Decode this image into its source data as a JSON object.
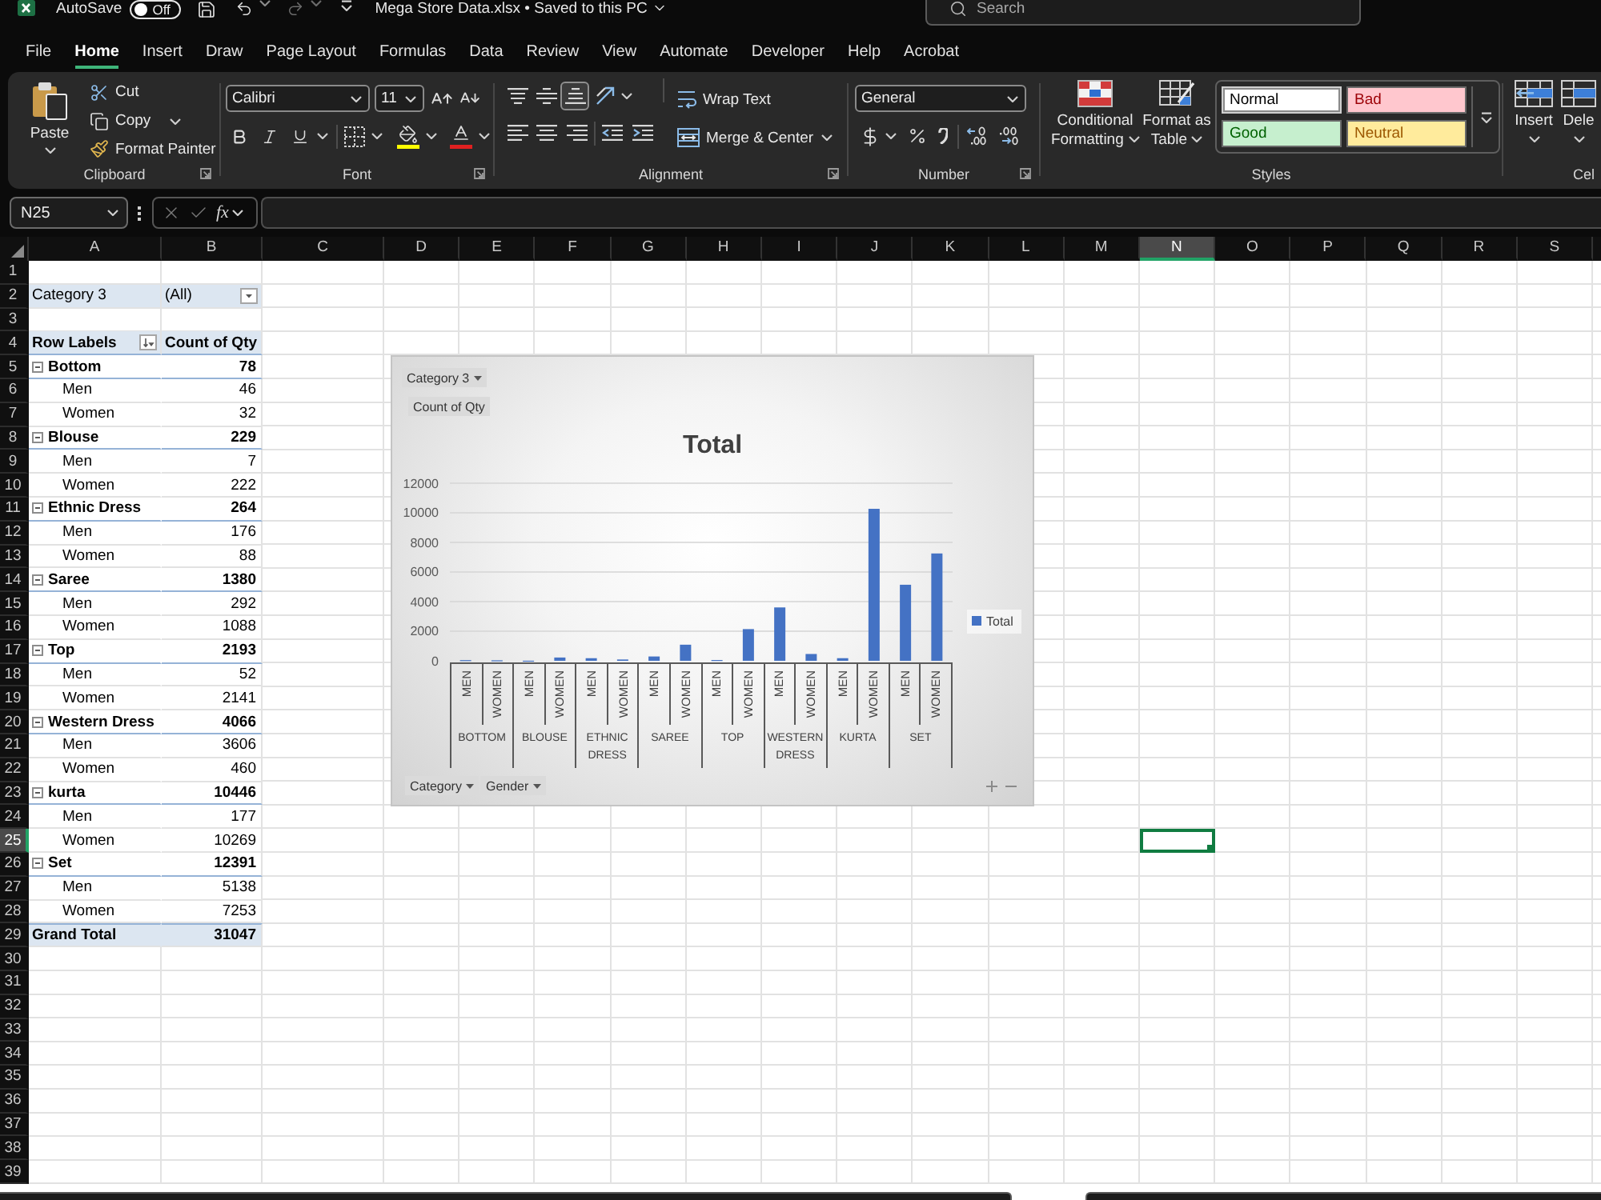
{
  "title_bar": {
    "autosave_label": "AutoSave",
    "autosave_toggle": {
      "label": "Off",
      "on": false
    },
    "document_title": "Mega Store Data.xlsx • Saved to this PC",
    "search": {
      "placeholder": "Search"
    }
  },
  "menu_tabs": [
    {
      "label": "File",
      "selected": false
    },
    {
      "label": "Home",
      "selected": true
    },
    {
      "label": "Insert",
      "selected": false
    },
    {
      "label": "Draw",
      "selected": false
    },
    {
      "label": "Page Layout",
      "selected": false
    },
    {
      "label": "Formulas",
      "selected": false
    },
    {
      "label": "Data",
      "selected": false
    },
    {
      "label": "Review",
      "selected": false
    },
    {
      "label": "View",
      "selected": false
    },
    {
      "label": "Automate",
      "selected": false
    },
    {
      "label": "Developer",
      "selected": false
    },
    {
      "label": "Help",
      "selected": false
    },
    {
      "label": "Acrobat",
      "selected": false
    }
  ],
  "ribbon": {
    "clipboard": {
      "label": "Clipboard",
      "paste": "Paste",
      "cut": "Cut",
      "copy": "Copy",
      "format_painter": "Format Painter"
    },
    "font": {
      "label": "Font",
      "font_name": "Calibri",
      "font_size": "11"
    },
    "alignment": {
      "label": "Alignment",
      "vertical": [
        {
          "kind": "top",
          "on": false
        },
        {
          "kind": "middle",
          "on": false
        },
        {
          "kind": "bottom",
          "on": true
        }
      ],
      "wrap_text": "Wrap Text",
      "merge_center": "Merge & Center"
    },
    "number": {
      "label": "Number",
      "format": "General"
    },
    "styles": {
      "label": "Styles",
      "conditional_formatting": "Conditional Formatting",
      "format_as_table": "Format as Table",
      "gallery": [
        {
          "label": "Normal",
          "kind": "normal",
          "color": "#ffffff"
        },
        {
          "label": "Bad",
          "kind": "bad",
          "color": "#ffc7ce"
        },
        {
          "label": "Good",
          "kind": "good",
          "color": "#c6efce"
        },
        {
          "label": "Neutral",
          "kind": "neutral",
          "color": "#ffeb9c"
        }
      ]
    },
    "cells": {
      "label": "Cel",
      "insert": "Insert",
      "delete": "Dele"
    }
  },
  "formula_bar": {
    "name_box": "N25",
    "function_button": "fx"
  },
  "sheet": {
    "columns": [
      {
        "label": "A",
        "selected": false
      },
      {
        "label": "B",
        "selected": false
      },
      {
        "label": "C",
        "selected": false
      },
      {
        "label": "D",
        "selected": false
      },
      {
        "label": "E",
        "selected": false
      },
      {
        "label": "F",
        "selected": false
      },
      {
        "label": "G",
        "selected": false
      },
      {
        "label": "H",
        "selected": false
      },
      {
        "label": "I",
        "selected": false
      },
      {
        "label": "J",
        "selected": false
      },
      {
        "label": "K",
        "selected": false
      },
      {
        "label": "L",
        "selected": false
      },
      {
        "label": "M",
        "selected": false
      },
      {
        "label": "N",
        "selected": true
      },
      {
        "label": "O",
        "selected": false
      },
      {
        "label": "P",
        "selected": false
      },
      {
        "label": "Q",
        "selected": false
      },
      {
        "label": "R",
        "selected": false
      },
      {
        "label": "S",
        "selected": false
      }
    ],
    "rows": [
      {
        "label": "1",
        "selected": false
      },
      {
        "label": "2",
        "selected": false
      },
      {
        "label": "3",
        "selected": false
      },
      {
        "label": "4",
        "selected": false
      },
      {
        "label": "5",
        "selected": false
      },
      {
        "label": "6",
        "selected": false
      },
      {
        "label": "7",
        "selected": false
      },
      {
        "label": "8",
        "selected": false
      },
      {
        "label": "9",
        "selected": false
      },
      {
        "label": "10",
        "selected": false
      },
      {
        "label": "11",
        "selected": false
      },
      {
        "label": "12",
        "selected": false
      },
      {
        "label": "13",
        "selected": false
      },
      {
        "label": "14",
        "selected": false
      },
      {
        "label": "15",
        "selected": false
      },
      {
        "label": "16",
        "selected": false
      },
      {
        "label": "17",
        "selected": false
      },
      {
        "label": "18",
        "selected": false
      },
      {
        "label": "19",
        "selected": false
      },
      {
        "label": "20",
        "selected": false
      },
      {
        "label": "21",
        "selected": false
      },
      {
        "label": "22",
        "selected": false
      },
      {
        "label": "23",
        "selected": false
      },
      {
        "label": "24",
        "selected": false
      },
      {
        "label": "25",
        "selected": true
      },
      {
        "label": "26",
        "selected": false
      },
      {
        "label": "27",
        "selected": false
      },
      {
        "label": "28",
        "selected": false
      },
      {
        "label": "29",
        "selected": false
      },
      {
        "label": "30",
        "selected": false
      },
      {
        "label": "31",
        "selected": false
      },
      {
        "label": "32",
        "selected": false
      },
      {
        "label": "33",
        "selected": false
      },
      {
        "label": "34",
        "selected": false
      },
      {
        "label": "35",
        "selected": false
      },
      {
        "label": "36",
        "selected": false
      },
      {
        "label": "37",
        "selected": false
      },
      {
        "label": "38",
        "selected": false
      },
      {
        "label": "39",
        "selected": false
      }
    ]
  },
  "pivot": {
    "filter": {
      "label": "Category 3",
      "value": "(All)"
    },
    "header": {
      "row_labels": "Row Labels",
      "values": "Count of Qty"
    },
    "groups": [
      {
        "label": "Bottom",
        "total": "78",
        "expanded": true,
        "children": [
          {
            "label": "Men",
            "value": "46"
          },
          {
            "label": "Women",
            "value": "32"
          }
        ]
      },
      {
        "label": "Blouse",
        "total": "229",
        "expanded": true,
        "children": [
          {
            "label": "Men",
            "value": "7"
          },
          {
            "label": "Women",
            "value": "222"
          }
        ]
      },
      {
        "label": "Ethnic Dress",
        "total": "264",
        "expanded": true,
        "children": [
          {
            "label": "Men",
            "value": "176"
          },
          {
            "label": "Women",
            "value": "88"
          }
        ]
      },
      {
        "label": "Saree",
        "total": "1380",
        "expanded": true,
        "children": [
          {
            "label": "Men",
            "value": "292"
          },
          {
            "label": "Women",
            "value": "1088"
          }
        ]
      },
      {
        "label": "Top",
        "total": "2193",
        "expanded": true,
        "children": [
          {
            "label": "Men",
            "value": "52"
          },
          {
            "label": "Women",
            "value": "2141"
          }
        ]
      },
      {
        "label": "Western Dress",
        "total": "4066",
        "expanded": true,
        "children": [
          {
            "label": "Men",
            "value": "3606"
          },
          {
            "label": "Women",
            "value": "460"
          }
        ]
      },
      {
        "label": "kurta",
        "total": "10446",
        "expanded": true,
        "children": [
          {
            "label": "Men",
            "value": "177"
          },
          {
            "label": "Women",
            "value": "10269"
          }
        ]
      },
      {
        "label": "Set",
        "total": "12391",
        "expanded": true,
        "children": [
          {
            "label": "Men",
            "value": "5138"
          },
          {
            "label": "Women",
            "value": "7253"
          }
        ]
      }
    ],
    "grand_total": {
      "label": "Grand Total",
      "value": "31047"
    }
  },
  "chart": {
    "filter_button": "Category 3",
    "value_button": "Count of Qty",
    "axis_groups": [
      "BOTTOM",
      "BLOUSE",
      "ETHNIC DRESS",
      "SAREE",
      "TOP",
      "WESTERN DRESS",
      "KURTA",
      "SET"
    ],
    "axis_buttons": [
      "Category",
      "Gender"
    ],
    "chart_data": {
      "type": "bar",
      "title": "Total",
      "categories": [
        "MEN",
        "WOMEN",
        "MEN",
        "WOMEN",
        "MEN",
        "WOMEN",
        "MEN",
        "WOMEN",
        "MEN",
        "WOMEN",
        "MEN",
        "WOMEN",
        "MEN",
        "WOMEN",
        "MEN",
        "WOMEN"
      ],
      "series": [
        {
          "name": "Total",
          "color": "#4472c4",
          "values": [
            46,
            32,
            7,
            222,
            176,
            88,
            292,
            1088,
            52,
            2141,
            3606,
            460,
            177,
            10269,
            5138,
            7253
          ]
        }
      ],
      "ylim": [
        0,
        12000
      ],
      "yticks": [
        0,
        2000,
        4000,
        6000,
        8000,
        10000,
        12000
      ],
      "grid": true
    }
  }
}
